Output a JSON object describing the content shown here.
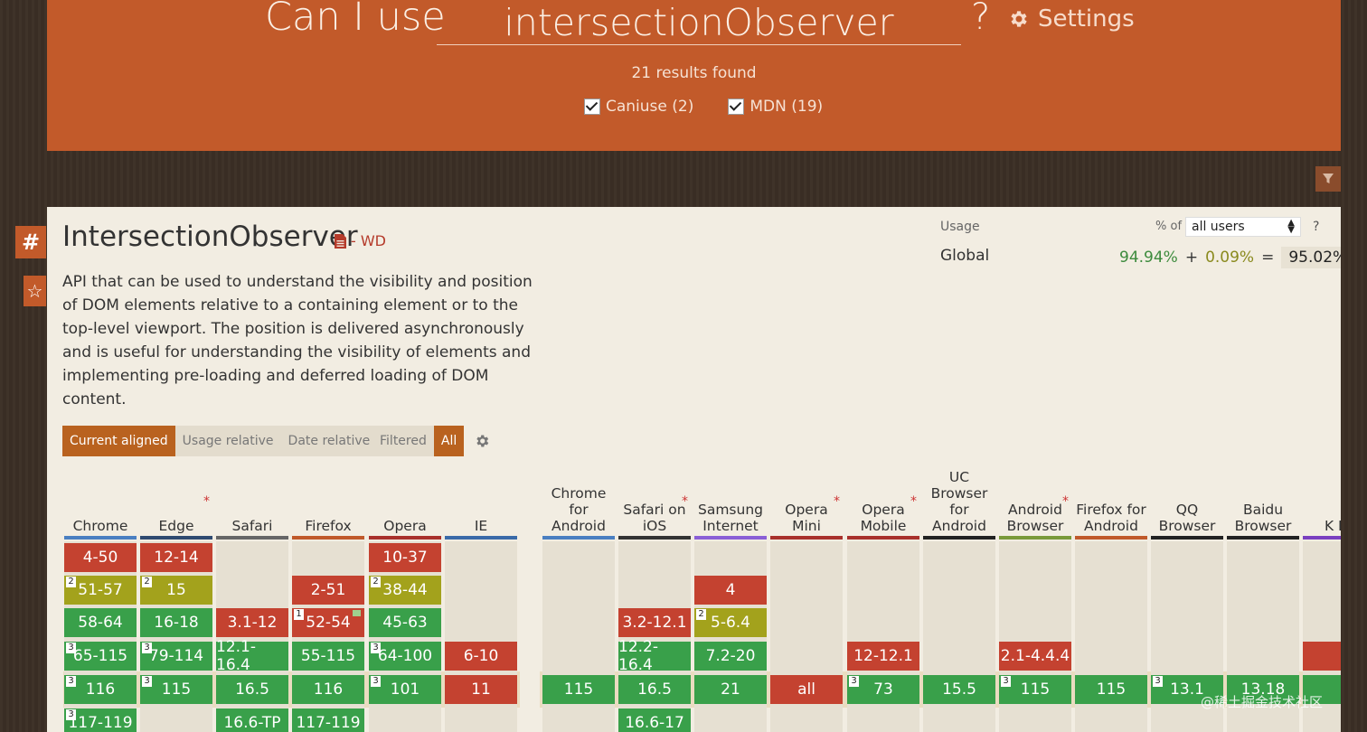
{
  "header": {
    "can_i_use": "Can I use",
    "search_value": "intersectionObserver",
    "question": "?",
    "settings_label": "Settings",
    "results": "21 results found",
    "filters": [
      "Caniuse (2)",
      "MDN (19)"
    ]
  },
  "side": {
    "hash": "#",
    "star": "☆"
  },
  "feature": {
    "title": "IntersectionObserver",
    "spec_status": "- WD",
    "description": "API that can be used to understand the visibility and position of DOM elements relative to a containing element or to the top-level viewport. The position is delivered asynchronously and is useful for understanding the visibility of elements and implementing pre-loading and deferred loading of DOM content."
  },
  "usage": {
    "label": "Usage",
    "pct_of": "% of",
    "users_option": "all users",
    "help": "?",
    "global_label": "Global",
    "full": "94.94%",
    "plus": "+",
    "partial": "0.09%",
    "equals": "=",
    "total": "95.02%"
  },
  "view_tabs": [
    "Current aligned",
    "Usage relative",
    "Date relative"
  ],
  "filter_tabs": [
    "Filtered",
    "All"
  ],
  "colors": {
    "supported": "#39a04a",
    "unsupported": "#c44230",
    "partial": "#a3a21c",
    "header_bg": "#c25a2a"
  },
  "browsers": [
    {
      "name": "Chrome",
      "bar": "#4a7fc1",
      "star": false,
      "cells": [
        [
          "n",
          "4-50",
          ""
        ],
        [
          "a",
          "51-57",
          "2"
        ],
        [
          "y",
          "58-64",
          ""
        ],
        [
          "y",
          "65-115",
          "3"
        ],
        [
          "y",
          "116",
          "3"
        ],
        [
          "y",
          "117-119",
          "3"
        ]
      ]
    },
    {
      "name": "Edge",
      "bar": "#2f4a70",
      "star": true,
      "cells": [
        [
          "n",
          "12-14",
          ""
        ],
        [
          "a",
          "15",
          "2"
        ],
        [
          "y",
          "16-18",
          ""
        ],
        [
          "y",
          "79-114",
          "3"
        ],
        [
          "y",
          "115",
          "3"
        ]
      ]
    },
    {
      "name": "Safari",
      "bar": "#666666",
      "star": false,
      "cells": [
        null,
        null,
        [
          "n",
          "3.1-12",
          ""
        ],
        [
          "y",
          "12.1-16.4",
          ""
        ],
        [
          "y",
          "16.5",
          ""
        ],
        [
          "y",
          "16.6-TP",
          ""
        ]
      ]
    },
    {
      "name": "Firefox",
      "bar": "#c0592a",
      "star": false,
      "cells": [
        null,
        [
          "n",
          "2-51",
          ""
        ],
        [
          "n",
          "52-54",
          "1"
        ],
        [
          "y",
          "55-115",
          ""
        ],
        [
          "y",
          "116",
          ""
        ],
        [
          "y",
          "117-119",
          ""
        ]
      ]
    },
    {
      "name": "Opera",
      "bar": "#a8302b",
      "star": false,
      "cells": [
        [
          "n",
          "10-37",
          ""
        ],
        [
          "a",
          "38-44",
          "2"
        ],
        [
          "y",
          "45-63",
          ""
        ],
        [
          "y",
          "64-100",
          "3"
        ],
        [
          "y",
          "101",
          "3"
        ]
      ]
    },
    {
      "name": "IE",
      "bar": "#3a6aa8",
      "star": false,
      "cells": [
        null,
        null,
        null,
        [
          "n",
          "6-10",
          ""
        ],
        [
          "n",
          "11",
          ""
        ]
      ]
    },
    {
      "name": "Chrome for Android",
      "bar": "#4a7fc1",
      "star": false,
      "cells": [
        null,
        null,
        null,
        null,
        [
          "y",
          "115",
          ""
        ]
      ]
    },
    {
      "name": "Safari on iOS",
      "bar": "#333333",
      "star": true,
      "cells": [
        null,
        null,
        [
          "n",
          "3.2-12.1",
          ""
        ],
        [
          "y",
          "12.2-16.4",
          ""
        ],
        [
          "y",
          "16.5",
          ""
        ],
        [
          "y",
          "16.6-17",
          ""
        ]
      ]
    },
    {
      "name": "Samsung Internet",
      "bar": "#8a5fd6",
      "star": false,
      "cells": [
        null,
        [
          "n",
          "4",
          ""
        ],
        [
          "a",
          "5-6.4",
          "2"
        ],
        [
          "y",
          "7.2-20",
          ""
        ],
        [
          "y",
          "21",
          ""
        ]
      ]
    },
    {
      "name": "Opera Mini",
      "bar": "#a8302b",
      "star": true,
      "cells": [
        null,
        null,
        null,
        null,
        [
          "n",
          "all",
          ""
        ]
      ]
    },
    {
      "name": "Opera Mobile",
      "bar": "#a8302b",
      "star": true,
      "cells": [
        null,
        null,
        null,
        [
          "n",
          "12-12.1",
          ""
        ],
        [
          "y",
          "73",
          "3"
        ]
      ]
    },
    {
      "name": "UC Browser for Android",
      "bar": "#222222",
      "star": false,
      "cells": [
        null,
        null,
        null,
        null,
        [
          "y",
          "15.5",
          ""
        ]
      ]
    },
    {
      "name": "Android Browser",
      "bar": "#7a9a3a",
      "star": true,
      "cells": [
        null,
        null,
        null,
        [
          "n",
          "2.1-4.4.4",
          ""
        ],
        [
          "y",
          "115",
          "3"
        ]
      ]
    },
    {
      "name": "Firefox for Android",
      "bar": "#c0592a",
      "star": false,
      "cells": [
        null,
        null,
        null,
        null,
        [
          "y",
          "115",
          ""
        ]
      ]
    },
    {
      "name": "QQ Browser",
      "bar": "#222222",
      "star": false,
      "cells": [
        null,
        null,
        null,
        null,
        [
          "y",
          "13.1",
          "3"
        ]
      ]
    },
    {
      "name": "Baidu Browser",
      "bar": "#222222",
      "star": false,
      "cells": [
        null,
        null,
        null,
        null,
        [
          "y",
          "13.18",
          ""
        ]
      ]
    },
    {
      "name": "K Br",
      "bar": "#7a3fc0",
      "star": false,
      "cells": [
        null,
        null,
        null,
        [
          "n",
          "",
          ""
        ],
        [
          "y",
          "",
          ""
        ]
      ]
    }
  ],
  "watermark": "@稀土掘金技术社区"
}
